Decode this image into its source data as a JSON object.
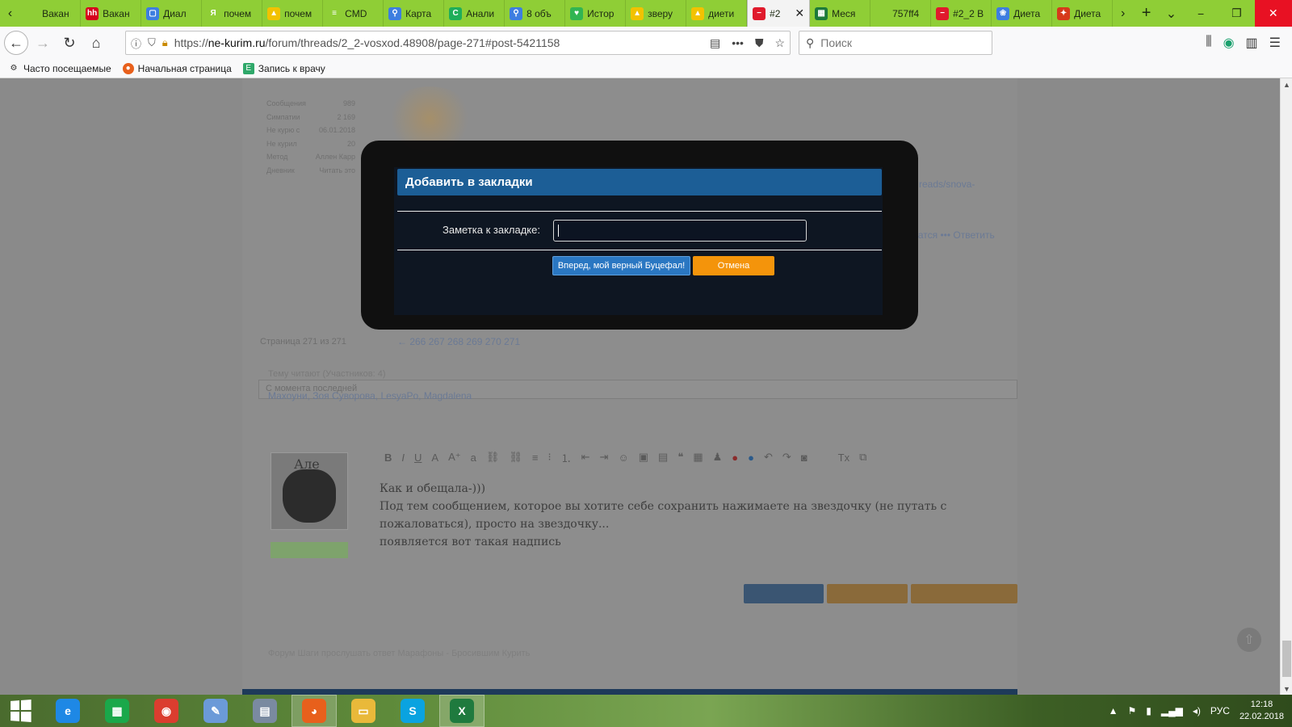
{
  "browser": {
    "tabs": [
      {
        "label": "Вакан",
        "icon_color": "#8fce36",
        "glyph": ""
      },
      {
        "label": "Вакан",
        "icon_color": "#d6001c",
        "glyph": "hh"
      },
      {
        "label": "Диал",
        "icon_color": "#3d7ee0",
        "glyph": "▢"
      },
      {
        "label": "почем",
        "icon_color": "#8fce36",
        "glyph": "Я"
      },
      {
        "label": "почем",
        "icon_color": "#f2c200",
        "glyph": "▲"
      },
      {
        "label": "CMD",
        "icon_color": "#8fce36",
        "glyph": "≡"
      },
      {
        "label": "Карта",
        "icon_color": "#3d7ee0",
        "glyph": "⚲"
      },
      {
        "label": "Анали",
        "icon_color": "#1fae5a",
        "glyph": "C"
      },
      {
        "label": "8 объ",
        "icon_color": "#3d7ee0",
        "glyph": "⚲"
      },
      {
        "label": "Истор",
        "icon_color": "#31b552",
        "glyph": "♥"
      },
      {
        "label": "зверу",
        "icon_color": "#f2c200",
        "glyph": "▲"
      },
      {
        "label": "диети",
        "icon_color": "#f2c200",
        "glyph": "▲"
      },
      {
        "label": "#2",
        "icon_color": "#e01a2c",
        "glyph": "−",
        "active": true
      },
      {
        "label": "Меся",
        "icon_color": "#1d7a3a",
        "glyph": "▦"
      },
      {
        "label": "757ff4",
        "icon_color": "#8fce36",
        "glyph": ""
      },
      {
        "label": "#2_2 В",
        "icon_color": "#e01a2c",
        "glyph": "−"
      },
      {
        "label": "Диета",
        "icon_color": "#3d7ee0",
        "glyph": "❀"
      },
      {
        "label": "Диета",
        "icon_color": "#d63a1a",
        "glyph": "✦"
      }
    ],
    "url_prefix": "https://",
    "url_host": "ne-kurim.ru",
    "url_path": "/forum/threads/2_2-vosxod.48908/page-271#post-5421158",
    "search_placeholder": "Поиск",
    "bookmarks": [
      {
        "label": "Часто посещаемые",
        "icon": "gear-icon"
      },
      {
        "label": "Начальная страница",
        "icon": "firefox-icon"
      },
      {
        "label": "Запись к врачу",
        "icon": "page-icon"
      }
    ]
  },
  "page": {
    "stats": [
      {
        "k": "Сообщения",
        "v": "989"
      },
      {
        "k": "Симпатии",
        "v": "2 169"
      },
      {
        "k": "Не курю с",
        "v": "06.01.2018"
      },
      {
        "k": "Не курил",
        "v": "20"
      },
      {
        "k": "Метод",
        "v": "Аллен Карр"
      },
      {
        "k": "Дневник",
        "v": "Читать это"
      }
    ],
    "link_fragment": "reads/snova-",
    "action_fragment": "цатся  •••  Ответить",
    "since_last": "С момента последней",
    "pager": "Страница 271 из 271",
    "pager_links": "←  266  267  268  269  270  271",
    "readers_label": "Тему читают (Участников: 4)",
    "readers": "Махоуни, Зоя Суворова, LesyaPo, Magdalena",
    "avatar_name": "Але",
    "editor_lines": [
      "Как и обещала-)))",
      "Под тем сообщением, которое вы хотите себе сохранить нажимаете на звездочку (не путать с",
      "пожаловаться), просто на звездочку...",
      "появляется вот такая надпись"
    ],
    "footer_links": "Форум     Шаги прослушать ответ     Марафоны - Бросившим Курить"
  },
  "dialog": {
    "title": "Добавить в закладки",
    "note_label": "Заметка к закладке:",
    "note_value": "",
    "submit_label": "Вперед, мой верный Буцефал!",
    "cancel_label": "Отмена",
    "colors": {
      "title_bg": "#1c5e96",
      "submit": "#2a77c2",
      "cancel": "#f4940b"
    }
  },
  "taskbar": {
    "apps": [
      {
        "name": "ie-icon",
        "glyph": "e",
        "color": "#1e88e5"
      },
      {
        "name": "store-icon",
        "glyph": "▦",
        "color": "#1aa84a"
      },
      {
        "name": "chrome-icon",
        "glyph": "◉",
        "color": "#db3d2f"
      },
      {
        "name": "paint-icon",
        "glyph": "✎",
        "color": "#6b9ad8"
      },
      {
        "name": "calculator-icon",
        "glyph": "▤",
        "color": "#7a8aa0"
      },
      {
        "name": "firefox-icon",
        "glyph": "◕",
        "color": "#e8601c",
        "active": true
      },
      {
        "name": "explorer-icon",
        "glyph": "▭",
        "color": "#e9b93a"
      },
      {
        "name": "skype-icon",
        "glyph": "S",
        "color": "#0aa3e0"
      },
      {
        "name": "excel-icon",
        "glyph": "X",
        "color": "#1f7a3e",
        "active": true
      }
    ],
    "language": "РУС",
    "time": "12:18",
    "date": "22.02.2018"
  }
}
